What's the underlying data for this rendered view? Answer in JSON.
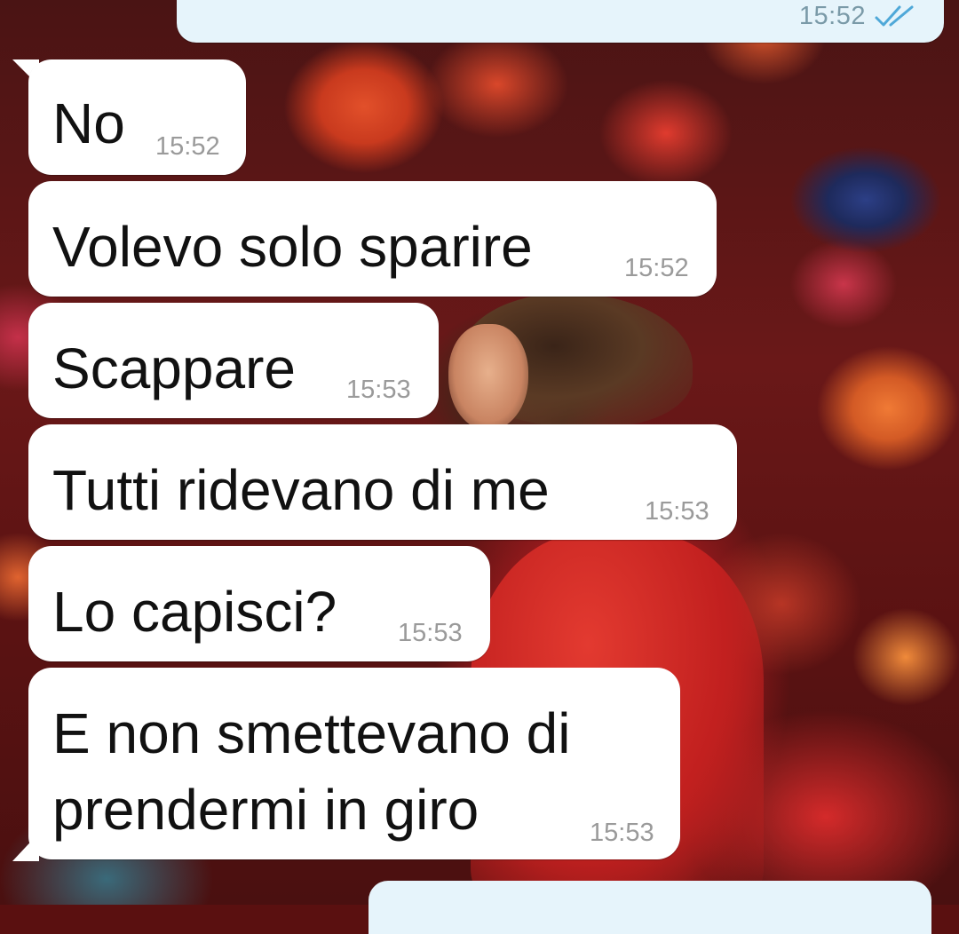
{
  "conversation": {
    "outgoing_top": {
      "time": "15:52",
      "status_icon": "double-check-icon"
    },
    "messages": [
      {
        "text": "No",
        "time": "15:52"
      },
      {
        "text": "Volevo solo sparire",
        "time": "15:52"
      },
      {
        "text": "Scappare",
        "time": "15:53"
      },
      {
        "text": "Tutti ridevano di me",
        "time": "15:53"
      },
      {
        "text": "Lo capisci?",
        "time": "15:53"
      },
      {
        "text_line1": "E non smettevano di",
        "text_line2": "prendermi in giro",
        "time": "15:53"
      }
    ]
  },
  "colors": {
    "incoming_bubble": "#ffffff",
    "outgoing_bubble": "#e6f4fb",
    "read_ticks": "#4fa8d8",
    "timestamp": "#9a9a9a"
  }
}
